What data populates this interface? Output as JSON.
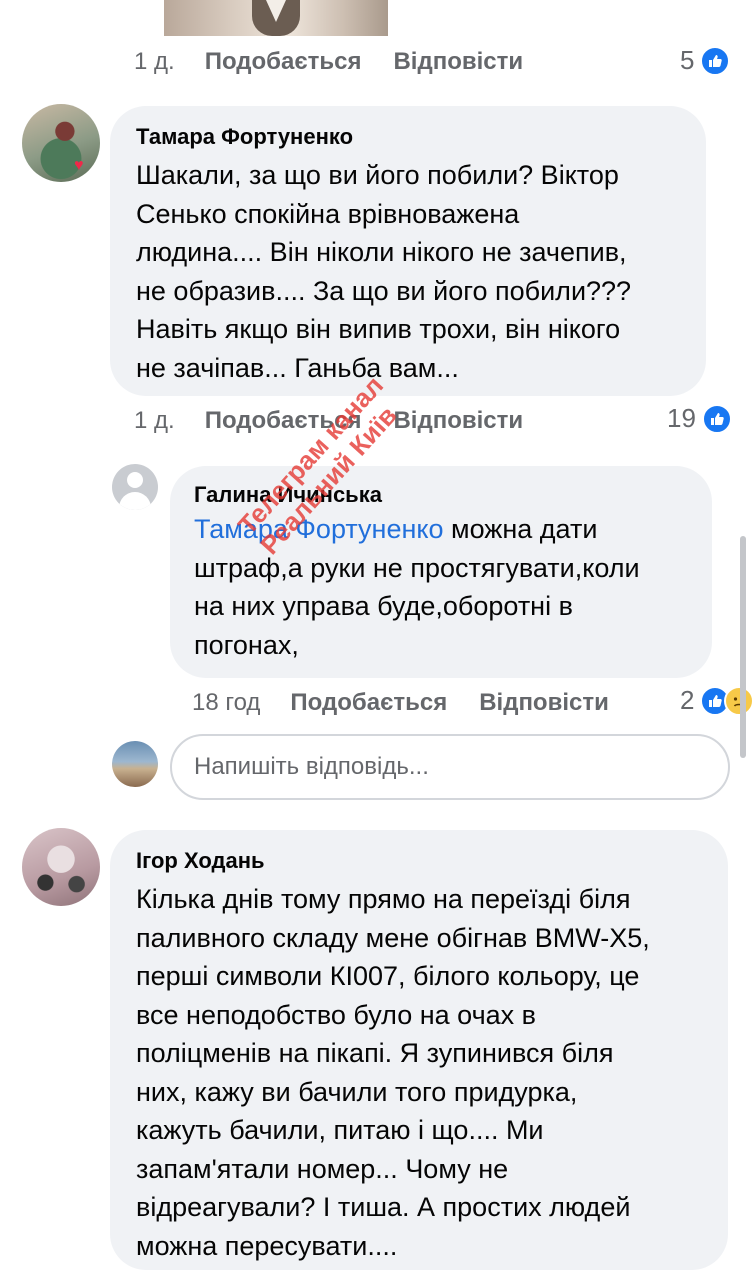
{
  "comments": [
    {
      "id": "prev",
      "time": "1 д.",
      "like_label": "Подобається",
      "reply_label": "Відповісти",
      "reaction_count": "5"
    },
    {
      "id": "tamara",
      "author": "Тамара Фортуненко",
      "text_lines": [
        "Шакали, за що ви його побили? Віктор",
        "Сенько спокійна врівноважена",
        "людина.... Він ніколи нікого не зачепив,",
        "не образив.... За що ви його побили???",
        "Навіть якщо він випив трохи, він нікого",
        "не зачіпав... Ганьба вам..."
      ],
      "time": "1 д.",
      "like_label": "Подобається",
      "reply_label": "Відповісти",
      "reaction_count": "19"
    },
    {
      "id": "galyna",
      "author": "Галина Ичинська",
      "mention": "Тамара Фортуненко",
      "text_first_rest": " можна дати",
      "text_lines": [
        "штраф,а руки не простягувати,коли",
        "на них управа буде,оборотні в",
        "погонах,"
      ],
      "time": "18 год",
      "like_label": "Подобається",
      "reply_label": "Відповісти",
      "reaction_count": "2"
    },
    {
      "id": "igor",
      "author": "Ігор Ходань",
      "text_lines": [
        "Кілька днів тому прямо на  переїзді біля",
        "паливного складу мене обігнав BMW-X5,",
        "перші символи КІ007, білого кольору, це",
        "все неподобство було на очах в",
        "поліцменів на пікапі. Я зупинився біля",
        "них, кажу ви бачили того придурка,",
        "кажуть бачили, питаю і що.... Ми",
        "запам'ятали номер... Чому не",
        "відреагували? І тиша. А простих людей",
        "можна пересувати...."
      ]
    }
  ],
  "reply_box": {
    "placeholder": "Напишіть відповідь..."
  },
  "watermark": {
    "line1": "Телеграм канал",
    "line2": "Реальний Київ"
  },
  "colors": {
    "like_blue": "#1877f2",
    "mention_blue": "#216fdb",
    "bubble_bg": "#f0f2f5",
    "meta_gray": "#65676b",
    "watermark_red": "#e53935"
  },
  "icons": [
    "like-icon",
    "sad-icon",
    "default-avatar-icon"
  ]
}
